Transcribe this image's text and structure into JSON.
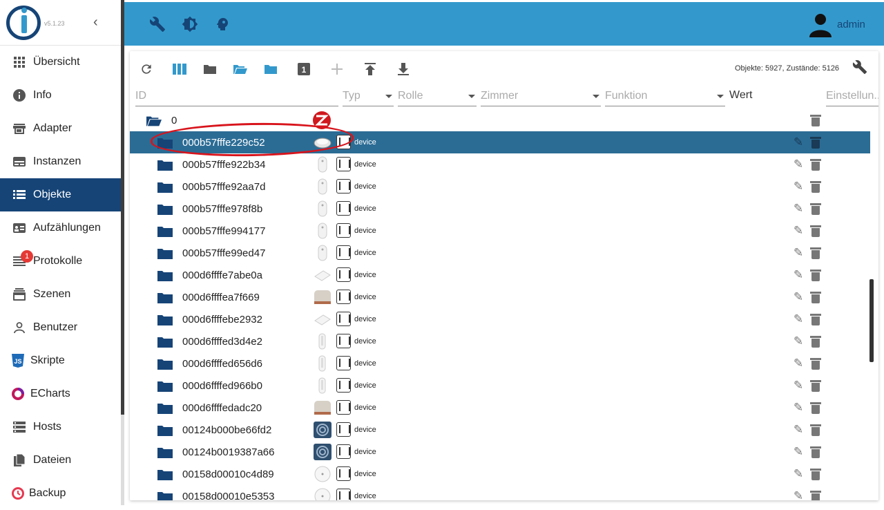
{
  "sidebar": {
    "version": "v5.1.23",
    "items": [
      {
        "label": "Übersicht",
        "icon": "apps-grid-icon",
        "active": false
      },
      {
        "label": "Info",
        "icon": "info-icon",
        "active": false
      },
      {
        "label": "Adapter",
        "icon": "store-icon",
        "active": false
      },
      {
        "label": "Instanzen",
        "icon": "instances-icon",
        "active": false
      },
      {
        "label": "Objekte",
        "icon": "list-icon",
        "active": true
      },
      {
        "label": "Aufzählungen",
        "icon": "enum-icon",
        "active": false
      },
      {
        "label": "Protokolle",
        "icon": "log-icon",
        "active": false,
        "badge": "1"
      },
      {
        "label": "Szenen",
        "icon": "scenes-icon",
        "active": false
      },
      {
        "label": "Benutzer",
        "icon": "user-icon",
        "active": false
      },
      {
        "label": "Skripte",
        "icon": "js-icon",
        "active": false
      },
      {
        "label": "ECharts",
        "icon": "echarts-icon",
        "active": false
      },
      {
        "label": "Hosts",
        "icon": "hosts-icon",
        "active": false
      },
      {
        "label": "Dateien",
        "icon": "files-icon",
        "active": false
      },
      {
        "label": "Backup",
        "icon": "backup-icon",
        "active": false
      }
    ]
  },
  "header": {
    "user": "admin",
    "color": "#3399cc"
  },
  "toolbar": {
    "stats": "Objekte: 5927, Zustände: 5126"
  },
  "filters": {
    "id": "ID",
    "type": "Typ",
    "role": "Rolle",
    "room": "Zimmer",
    "function": "Funktion",
    "value": "Wert",
    "settings": "Einstellun..."
  },
  "tree": {
    "root": "0",
    "rows": [
      {
        "id": "000b57fffe229c52",
        "type": "device",
        "selected": true
      },
      {
        "id": "000b57fffe922b34",
        "type": "device"
      },
      {
        "id": "000b57fffe92aa7d",
        "type": "device"
      },
      {
        "id": "000b57fffe978f8b",
        "type": "device"
      },
      {
        "id": "000b57fffe994177",
        "type": "device"
      },
      {
        "id": "000b57fffe99ed47",
        "type": "device"
      },
      {
        "id": "000d6ffffe7abe0a",
        "type": "device"
      },
      {
        "id": "000d6ffffea7f669",
        "type": "device"
      },
      {
        "id": "000d6ffffebe2932",
        "type": "device"
      },
      {
        "id": "000d6ffffed3d4e2",
        "type": "device"
      },
      {
        "id": "000d6ffffed656d6",
        "type": "device"
      },
      {
        "id": "000d6ffffed966b0",
        "type": "device"
      },
      {
        "id": "000d6ffffedadc20",
        "type": "device"
      },
      {
        "id": "00124b000be66fd2",
        "type": "device"
      },
      {
        "id": "00124b0019387a66",
        "type": "device"
      },
      {
        "id": "00158d00010c4d89",
        "type": "device"
      },
      {
        "id": "00158d00010e5353",
        "type": "device"
      }
    ]
  }
}
